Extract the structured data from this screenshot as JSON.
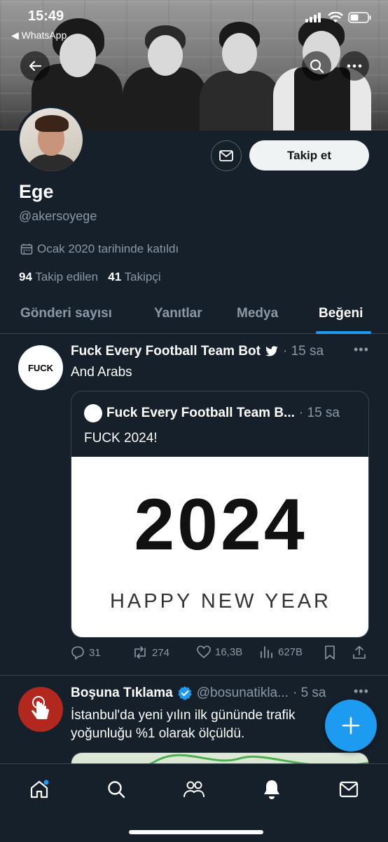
{
  "status_bar": {
    "time": "15:49",
    "back_app": "◀ WhatsApp"
  },
  "profile": {
    "name": "Ege",
    "handle": "@akersoyege",
    "joined": "Ocak 2020 tarihinde katıldı",
    "following_count": "94",
    "following_label": "Takip edilen",
    "followers_count": "41",
    "followers_label": "Takipçi",
    "follow_button": "Takip et"
  },
  "tabs": [
    {
      "label": "Gönderi sayısı"
    },
    {
      "label": "Yanıtlar"
    },
    {
      "label": "Medya"
    },
    {
      "label": "Beğeni",
      "active": true
    }
  ],
  "tweets": [
    {
      "author": "Fuck Every Football Team Bot",
      "meta": "· 15 sa",
      "text": "And Arabs",
      "avatar_text": "FUCK",
      "quote": {
        "author": "Fuck Every Football Team B...",
        "meta": "· 15 sa",
        "text": "FUCK 2024!",
        "image_year": "2024",
        "image_caption": "HAPPY NEW YEAR"
      },
      "actions": {
        "replies": "31",
        "retweets": "274",
        "likes": "16,3B",
        "views": "627B"
      }
    },
    {
      "author": "Boşuna Tıklama",
      "meta_handle": "@bosunatikla...",
      "meta_time": "· 5 sa",
      "text_line1": "İstanbul'da yeni yılın ilk gününde trafik",
      "text_line2": "yoğunluğu %1 olarak ölçüldü."
    }
  ],
  "colors": {
    "background": "#15202b",
    "accent": "#1d9bf0",
    "muted": "#8b98a5",
    "border": "#38444d"
  }
}
